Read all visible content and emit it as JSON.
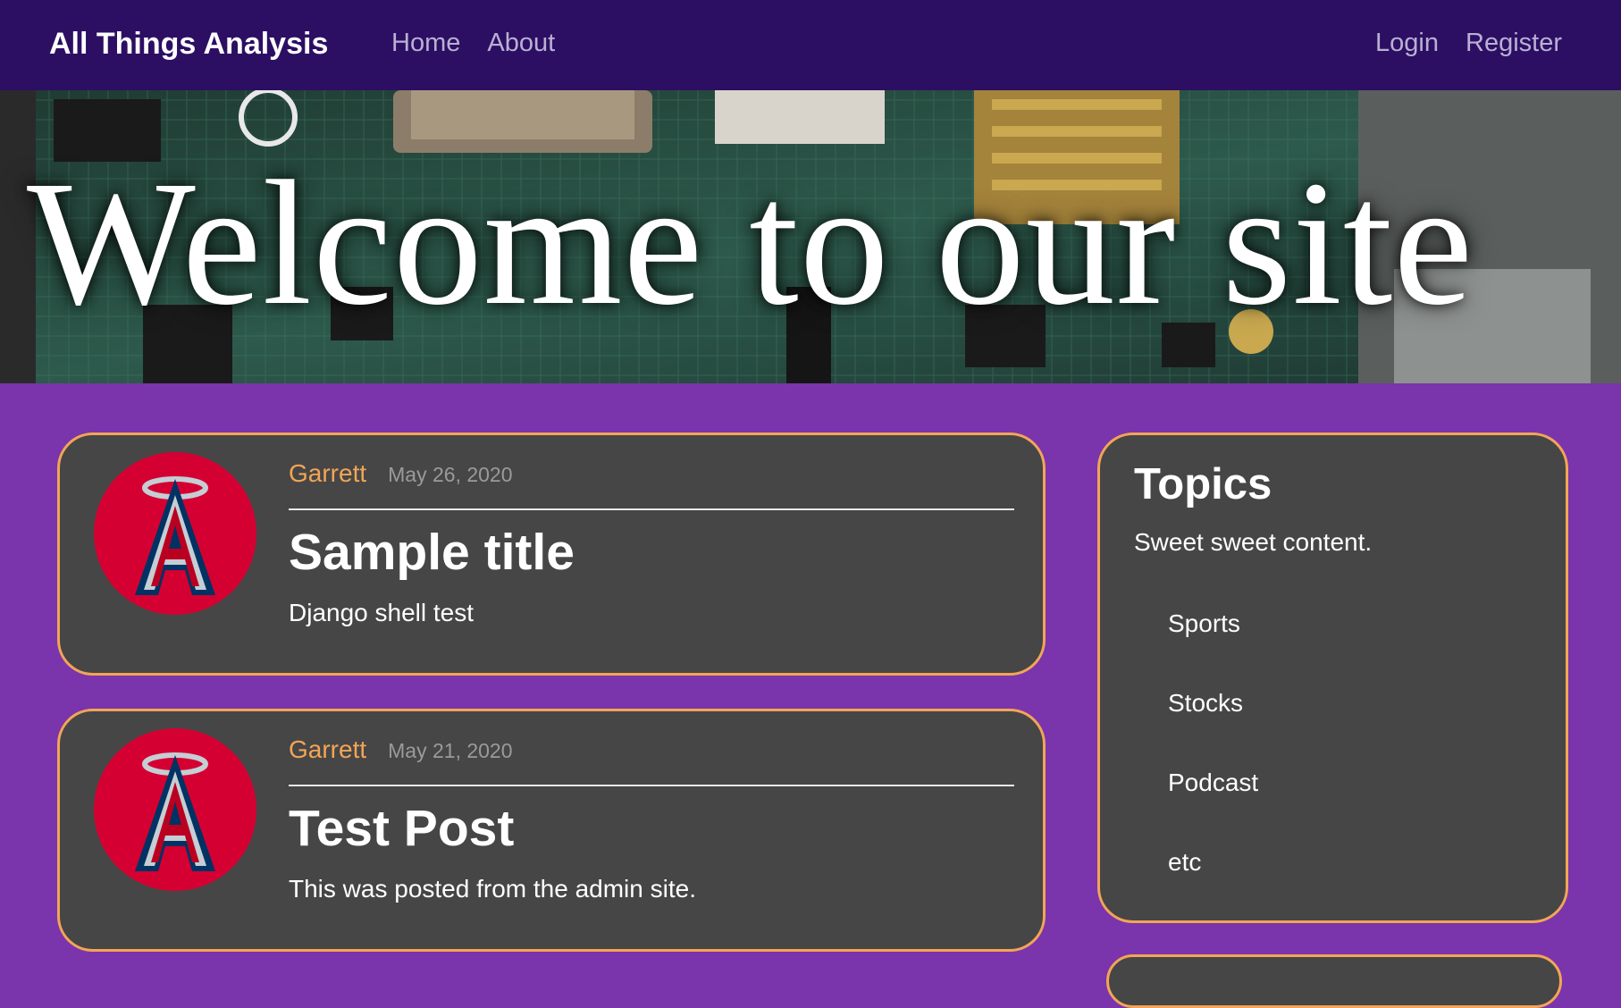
{
  "navbar": {
    "brand": "All Things Analysis",
    "left_links": [
      "Home",
      "About"
    ],
    "right_links": [
      "Login",
      "Register"
    ]
  },
  "hero": {
    "title": "Welcome to our site"
  },
  "posts": [
    {
      "author": "Garrett",
      "date": "May 26, 2020",
      "title": "Sample title",
      "body": "Django shell test",
      "avatar_icon": "angels-logo-icon"
    },
    {
      "author": "Garrett",
      "date": "May 21, 2020",
      "title": "Test Post",
      "body": "This was posted from the admin site.",
      "avatar_icon": "angels-logo-icon"
    }
  ],
  "sidebar": {
    "title": "Topics",
    "subtitle": "Sweet sweet content.",
    "items": [
      "Sports",
      "Stocks",
      "Podcast",
      "etc"
    ]
  },
  "colors": {
    "navbar_bg": "#2c0f63",
    "page_bg": "#7a34ac",
    "card_bg": "#464646",
    "accent": "#f2a556",
    "logo_red": "#d50032",
    "logo_navy": "#003263"
  }
}
